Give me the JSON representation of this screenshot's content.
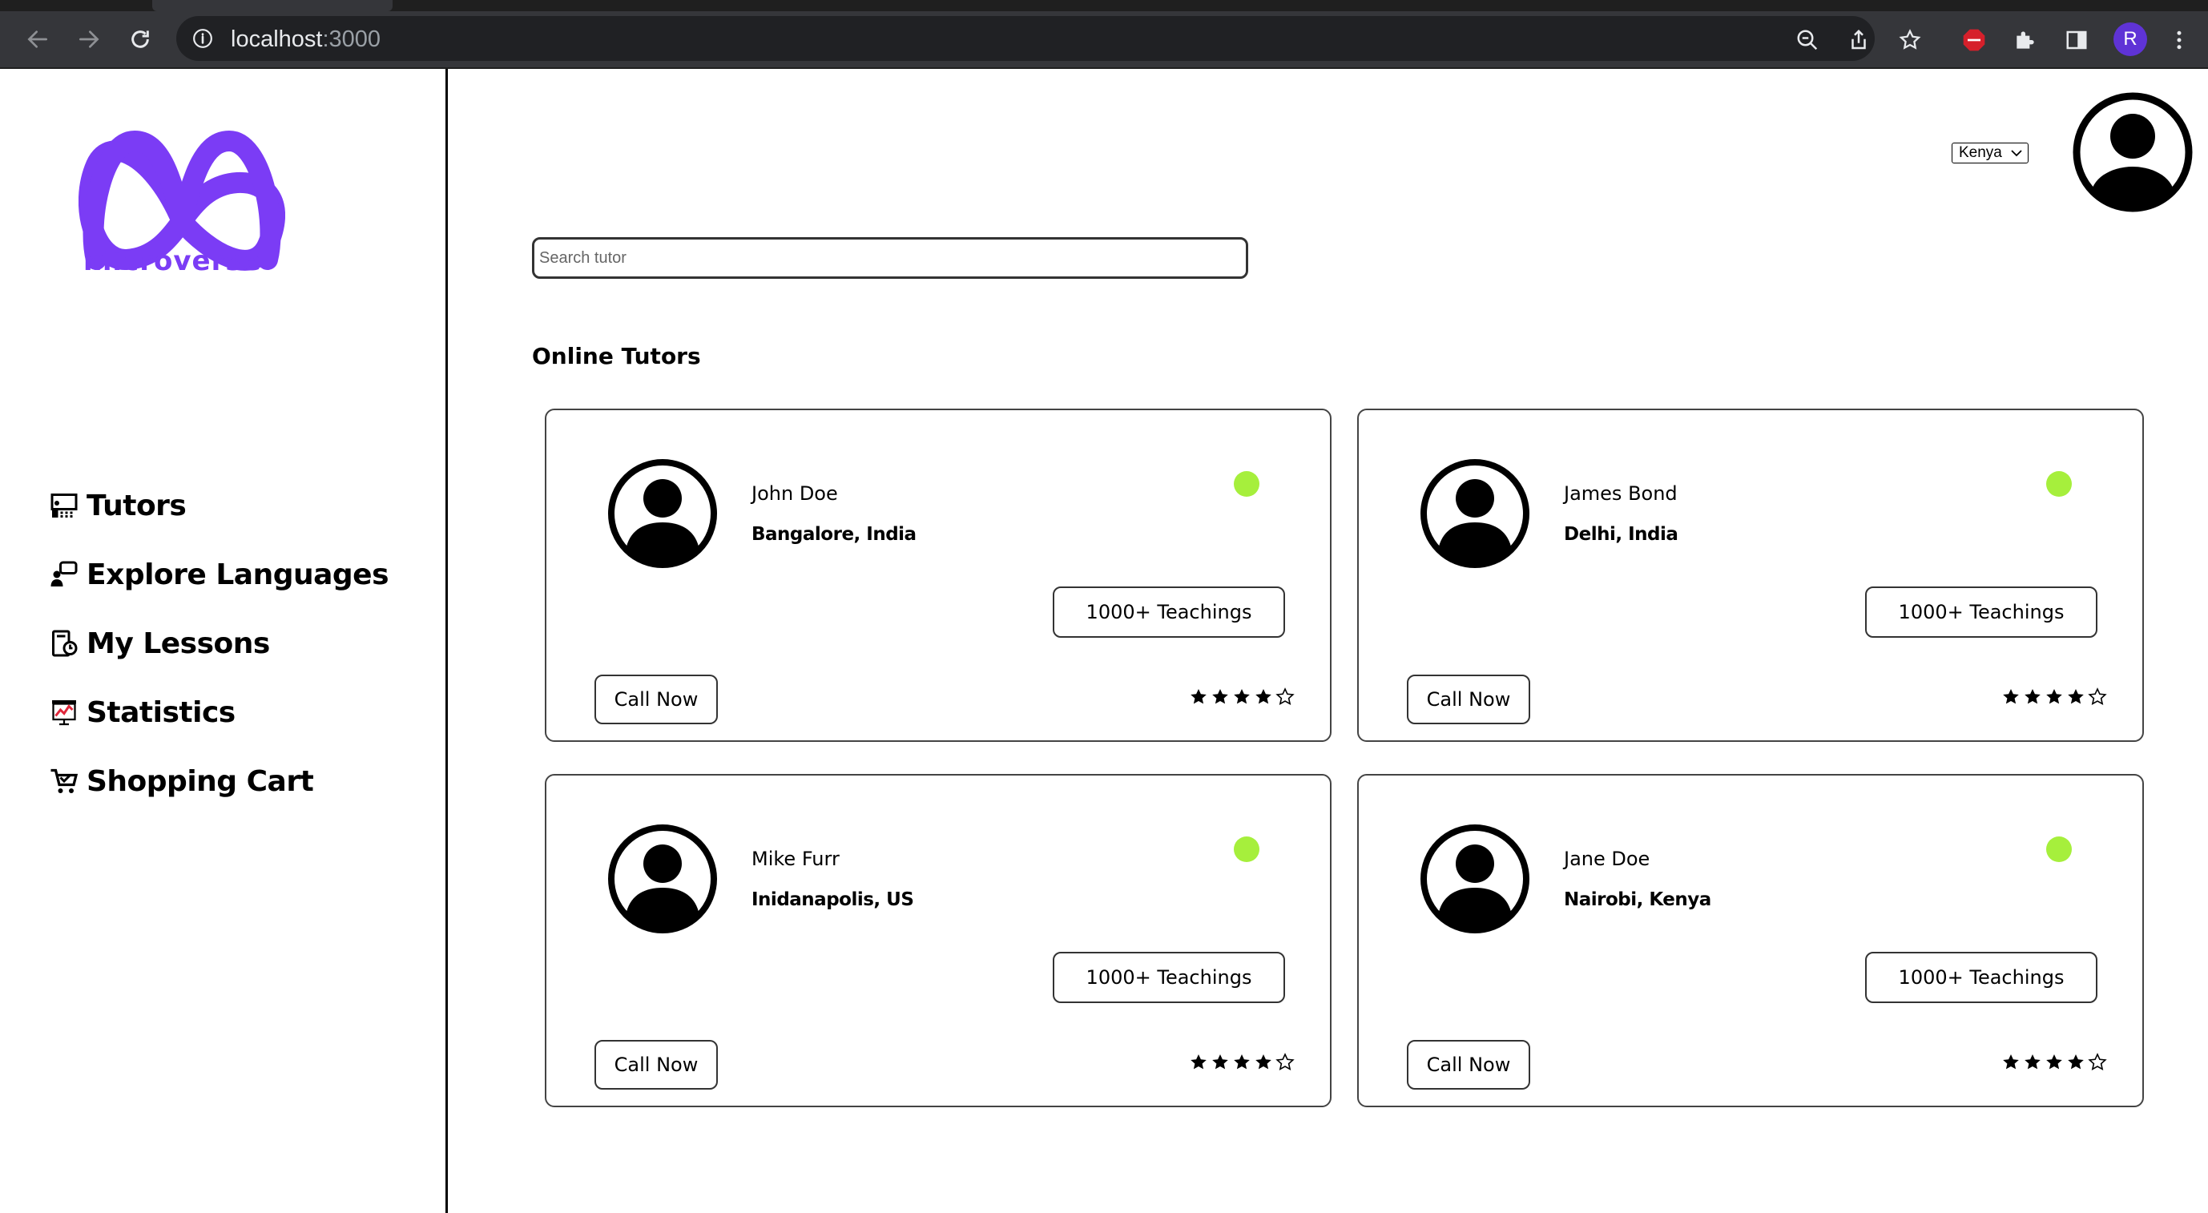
{
  "browser": {
    "url_host": "localhost",
    "url_port": ":3000",
    "profile_initial": "R"
  },
  "brand": {
    "name": "microverse",
    "color": "#7b3cf5"
  },
  "sidebar": {
    "items": [
      {
        "label": "Tutors",
        "icon": "tutor-icon"
      },
      {
        "label": "Explore Languages",
        "icon": "chat-person-icon"
      },
      {
        "label": "My Lessons",
        "icon": "lessons-icon"
      },
      {
        "label": "Statistics",
        "icon": "statistics-icon"
      },
      {
        "label": "Shopping Cart",
        "icon": "cart-icon"
      }
    ]
  },
  "header": {
    "country": "Kenya"
  },
  "search": {
    "placeholder": "Search tutor",
    "value": ""
  },
  "main": {
    "section_title": "Online Tutors",
    "status_color": "#a6ef3c",
    "tutors": [
      {
        "name": "John Doe",
        "location": "Bangalore, India",
        "teachings": "1000+ Teachings",
        "call_label": "Call Now",
        "rating": 4,
        "max_rating": 5
      },
      {
        "name": "James Bond",
        "location": "Delhi, India",
        "teachings": "1000+ Teachings",
        "call_label": "Call Now",
        "rating": 4,
        "max_rating": 5
      },
      {
        "name": "Mike Furr",
        "location": "Inidanapolis, US",
        "teachings": "1000+ Teachings",
        "call_label": "Call Now",
        "rating": 4,
        "max_rating": 5
      },
      {
        "name": "Jane Doe",
        "location": "Nairobi, Kenya",
        "teachings": "1000+ Teachings",
        "call_label": "Call Now",
        "rating": 4,
        "max_rating": 5
      }
    ]
  }
}
